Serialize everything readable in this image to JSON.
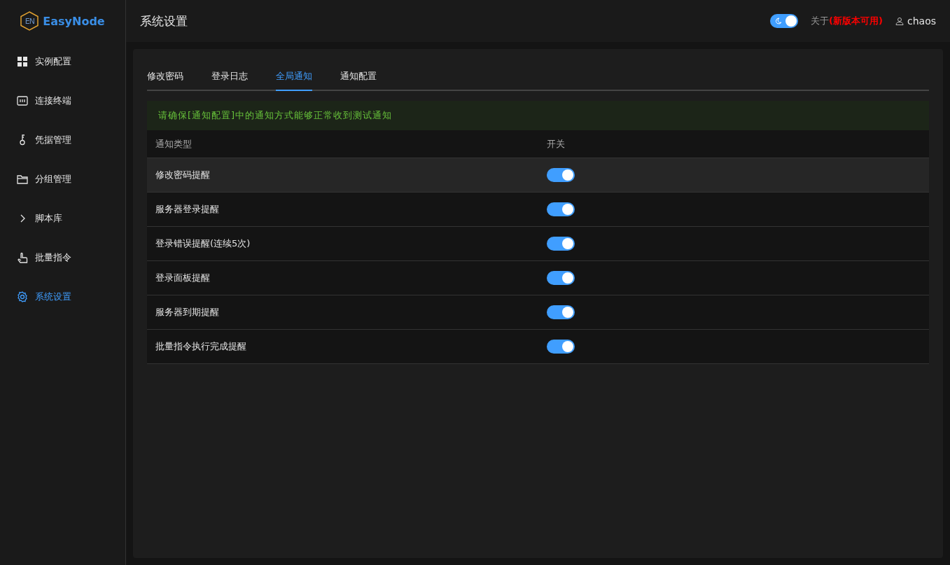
{
  "logo": {
    "mark": "EN",
    "name": "EasyNode"
  },
  "sidebar": {
    "items": [
      {
        "label": "实例配置",
        "selected": false
      },
      {
        "label": "连接终端",
        "selected": false
      },
      {
        "label": "凭据管理",
        "selected": false
      },
      {
        "label": "分组管理",
        "selected": false
      },
      {
        "label": "脚本库",
        "selected": false
      },
      {
        "label": "批量指令",
        "selected": false
      },
      {
        "label": "系统设置",
        "selected": true
      }
    ]
  },
  "header": {
    "title": "系统设置",
    "dark_mode": true,
    "about": "关于",
    "update_notice": "(新版本可用)",
    "user": "chaos"
  },
  "tabs": [
    {
      "label": "修改密码",
      "selected": false
    },
    {
      "label": "登录日志",
      "selected": false
    },
    {
      "label": "全局通知",
      "selected": true
    },
    {
      "label": "通知配置",
      "selected": false
    }
  ],
  "alert": "请确保[通知配置]中的通知方式能够正常收到测试通知",
  "table": {
    "columns": [
      "通知类型",
      "开关"
    ],
    "rows": [
      {
        "type": "修改密码提醒",
        "on": true,
        "highlighted": true
      },
      {
        "type": "服务器登录提醒",
        "on": true,
        "highlighted": false
      },
      {
        "type": "登录错误提醒(连续5次)",
        "on": true,
        "highlighted": false
      },
      {
        "type": "登录面板提醒",
        "on": true,
        "highlighted": false
      },
      {
        "type": "服务器到期提醒",
        "on": true,
        "highlighted": false
      },
      {
        "type": "批量指令执行完成提醒",
        "on": true,
        "highlighted": false
      }
    ]
  }
}
